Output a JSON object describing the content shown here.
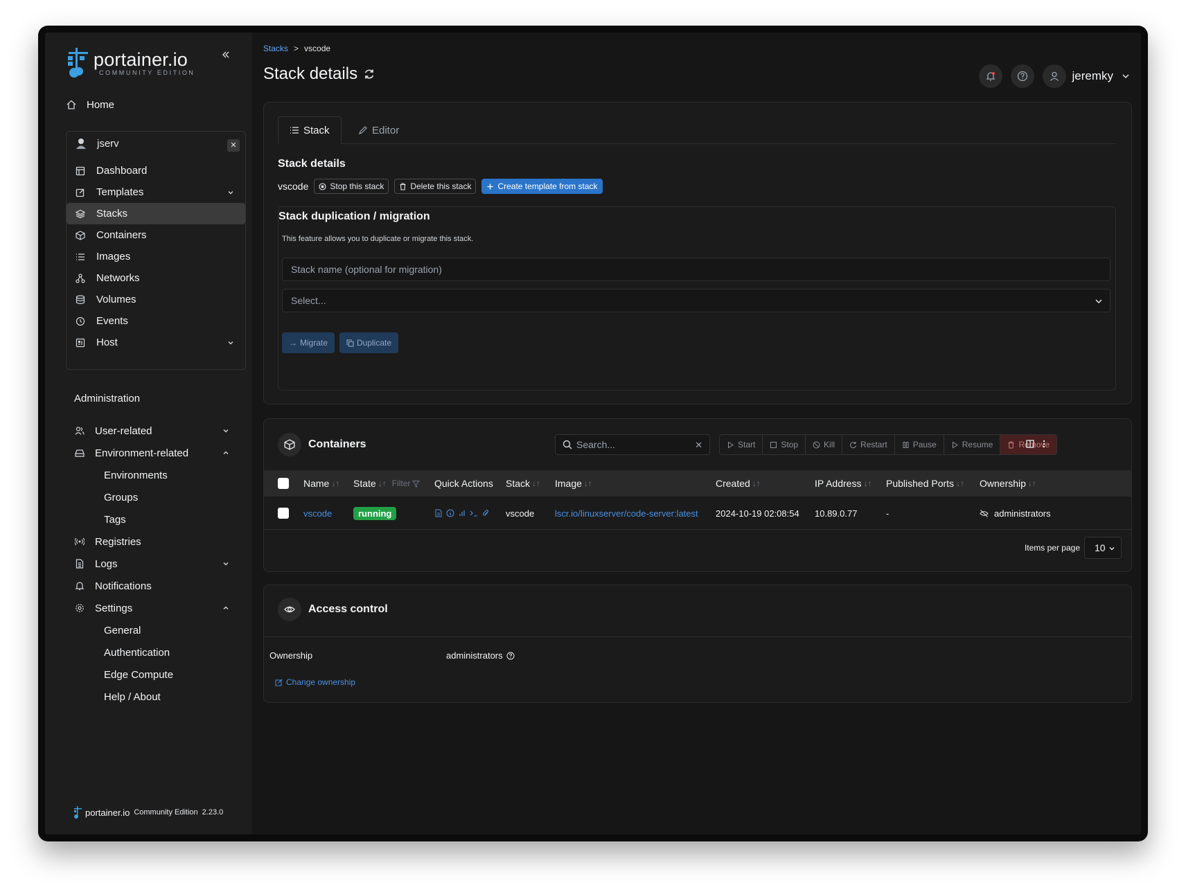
{
  "brand": {
    "name": "portainer.io",
    "edition_upper": "COMMUNITY EDITION",
    "footer_edition": "Community Edition",
    "version": "2.23.0"
  },
  "sidebar": {
    "home_label": "Home",
    "environment": {
      "name": "jserv",
      "items": [
        {
          "label": "Dashboard",
          "icon": "dashboard-icon"
        },
        {
          "label": "Templates",
          "icon": "edit-icon"
        },
        {
          "label": "Stacks",
          "icon": "layers-icon"
        },
        {
          "label": "Containers",
          "icon": "box-icon"
        },
        {
          "label": "Images",
          "icon": "list-icon"
        },
        {
          "label": "Networks",
          "icon": "network-icon"
        },
        {
          "label": "Volumes",
          "icon": "database-icon"
        },
        {
          "label": "Events",
          "icon": "clock-icon"
        },
        {
          "label": "Host",
          "icon": "host-icon"
        }
      ]
    },
    "administration_title": "Administration",
    "admin_items": [
      {
        "label": "User-related"
      },
      {
        "label": "Environment-related"
      },
      {
        "label": "Registries"
      },
      {
        "label": "Logs"
      },
      {
        "label": "Notifications"
      },
      {
        "label": "Settings"
      }
    ],
    "environment_sub": [
      "Environments",
      "Groups",
      "Tags"
    ],
    "settings_sub": [
      "General",
      "Authentication",
      "Edge Compute",
      "Help / About"
    ]
  },
  "header": {
    "breadcrumb_root": "Stacks",
    "breadcrumb_sep": ">",
    "breadcrumb_current": "vscode",
    "title": "Stack details",
    "user": "jeremky"
  },
  "stack_card": {
    "tab_stack": "Stack",
    "tab_editor": "Editor",
    "section_title": "Stack details",
    "stack_name": "vscode",
    "stop_label": "Stop this stack",
    "delete_label": "Delete this stack",
    "template_label": "Create template from stack",
    "dup_title": "Stack duplication / migration",
    "dup_desc": "This feature allows you to duplicate or migrate this stack.",
    "name_placeholder": "Stack name (optional for migration)",
    "select_placeholder": "Select...",
    "migrate_label": "Migrate",
    "duplicate_label": "Duplicate"
  },
  "containers": {
    "title": "Containers",
    "search_placeholder": "Search...",
    "actions": [
      "Start",
      "Stop",
      "Kill",
      "Restart",
      "Pause",
      "Resume",
      "Remove"
    ],
    "columns": {
      "name": "Name",
      "state": "State",
      "filter": "Filter",
      "quick_actions": "Quick Actions",
      "stack": "Stack",
      "image": "Image",
      "created": "Created",
      "ip": "IP Address",
      "ports": "Published Ports",
      "ownership": "Ownership"
    },
    "rows": [
      {
        "name": "vscode",
        "state": "running",
        "stack": "vscode",
        "image": "lscr.io/linuxserver/code-server:latest",
        "created": "2024-10-19 02:08:54",
        "ip": "10.89.0.77",
        "ports": "-",
        "ownership": "administrators"
      }
    ],
    "items_per_page_label": "Items per page",
    "items_per_page": "10"
  },
  "access": {
    "title": "Access control",
    "ownership_label": "Ownership",
    "ownership_value": "administrators",
    "change_label": "Change ownership"
  },
  "colors": {
    "accent": "#2a74c9",
    "running": "#22a046",
    "danger": "#4a1f1f"
  }
}
